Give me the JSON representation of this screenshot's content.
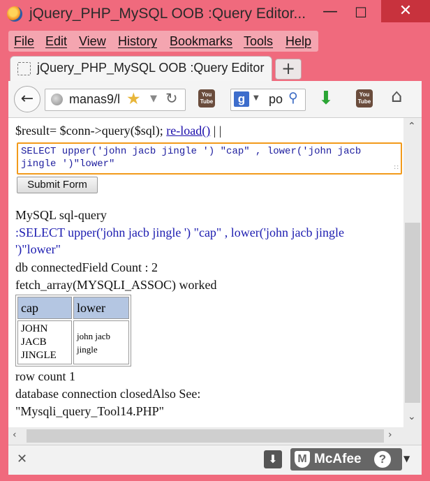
{
  "window": {
    "title": "jQuery_PHP_MySQL OOB :Query Editor...",
    "minimize": "—",
    "maximize": "☐",
    "close": "✕"
  },
  "menu": [
    "File",
    "Edit",
    "View",
    "History",
    "Bookmarks",
    "Tools",
    "Help"
  ],
  "tab": {
    "title": "jQuery_PHP_MySQL OOB :Query Editor",
    "new_tab": "+"
  },
  "nav": {
    "url": "manas9/l",
    "search_text": "po",
    "back_icon": "back-arrow-icon",
    "home_icon": "home-icon"
  },
  "content": {
    "code_line": "$result= $conn->query($sql);",
    "reload_link": "re-load()",
    "separators": " | |",
    "sql_text": "SELECT upper('john jacb jingle ') \"cap\" , lower('john jacb jingle ')\"lower\"",
    "submit_label": "Submit Form",
    "sql_query_heading": "MySQL sql-query",
    "echo_query_line1": ":SELECT upper('john jacb jingle ') \"cap\" , lower('john jacb jingle",
    "echo_query_line2": "')\"lower\"",
    "db_connected": "db connectedField Count : 2",
    "fetch_status": "fetch_array(MYSQLI_ASSOC) worked",
    "table": {
      "headers": [
        "cap",
        "lower"
      ],
      "rows": [
        [
          "JOHN JACB JINGLE",
          "john jacb jingle"
        ]
      ]
    },
    "row_count": "row count 1",
    "closed_line": "database connection closedAlso See:",
    "see_also": "\"Mysqli_query_Tool14.PHP\""
  },
  "addon_bar": {
    "mcafee_label": "McAfee",
    "help": "?"
  },
  "colors": {
    "titlebar": "#f06a7d",
    "accent_orange": "#f29a1b",
    "table_header": "#b4c6e2"
  }
}
